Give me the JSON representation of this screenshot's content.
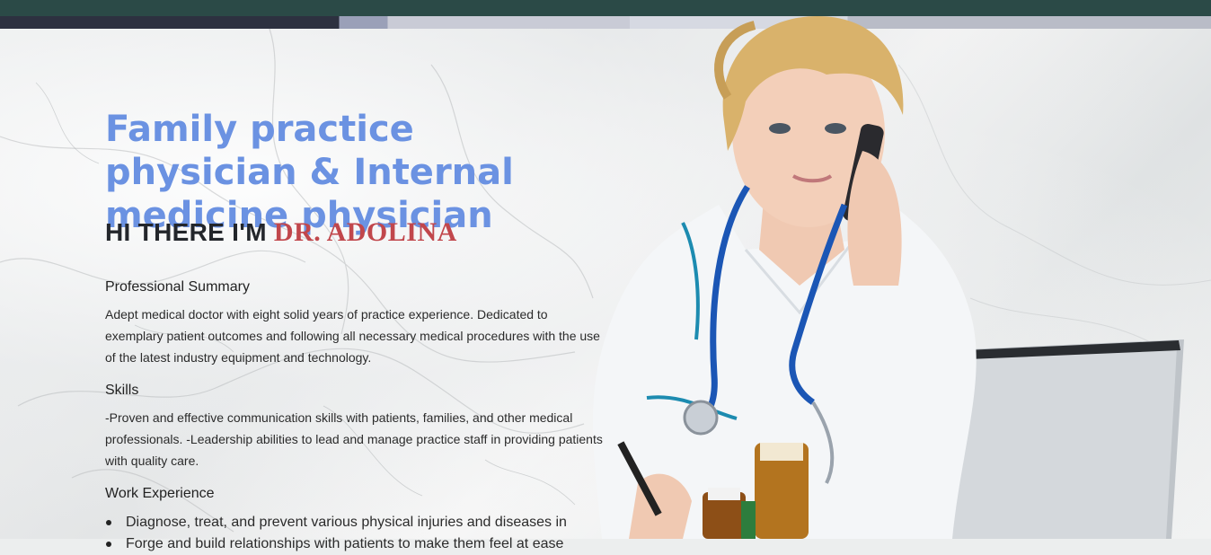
{
  "hero": {
    "title": "Family practice physician & Internal medicine physician",
    "greeting_prefix": "HI THERE I'M",
    "greeting_name": "DR. ADOLINA"
  },
  "sections": {
    "summary_heading": "Professional Summary",
    "summary_text": "Adept medical doctor with eight solid years of practice experience. Dedicated to exemplary patient outcomes and following all necessary medical procedures with the use of the latest industry equipment and technology.",
    "skills_heading": "Skills",
    "skills_text": "-Proven and effective communication skills with patients, families, and other medical professionals. -Leadership abilities to lead and manage practice staff in providing patients with quality care.",
    "work_heading": "Work Experience",
    "work_items": [
      "Diagnose, treat, and prevent various physical injuries and diseases in",
      "Forge and build relationships with patients to make them feel at ease"
    ]
  },
  "colors": {
    "topbar": "#2b4a47",
    "title": "#6b92e2",
    "name": "#c1474c",
    "text": "#2b2b2b"
  },
  "photo": {
    "alt_name": "doctor-photo"
  }
}
